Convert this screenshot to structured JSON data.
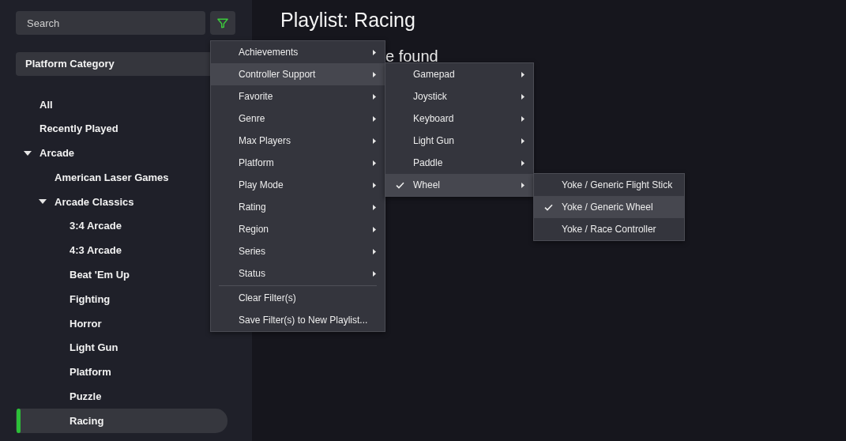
{
  "sidebar": {
    "search": {
      "placeholder": "Search"
    },
    "category_dropdown": {
      "value": "Platform Category"
    },
    "tree": [
      {
        "label": "All",
        "selected": false
      },
      {
        "label": "Recently Played",
        "selected": false
      },
      {
        "label": "Arcade",
        "selected": false,
        "expanded": true,
        "children": [
          {
            "label": "American Laser Games",
            "selected": false
          },
          {
            "label": "Arcade Classics",
            "selected": false,
            "expanded": true,
            "children": [
              {
                "label": "3:4 Arcade",
                "selected": false
              },
              {
                "label": "4:3 Arcade",
                "selected": false
              },
              {
                "label": "Beat 'Em Up",
                "selected": false
              },
              {
                "label": "Fighting",
                "selected": false
              },
              {
                "label": "Horror",
                "selected": false
              },
              {
                "label": "Light Gun",
                "selected": false
              },
              {
                "label": "Platform",
                "selected": false
              },
              {
                "label": "Puzzle",
                "selected": false
              },
              {
                "label": "Racing",
                "selected": true
              }
            ]
          }
        ]
      }
    ]
  },
  "main": {
    "title": "Playlist: Racing",
    "message": "e found"
  },
  "filter_menu": {
    "sections": [
      {
        "items": [
          {
            "label": "Achievements",
            "kind": "submenu",
            "highlighted": false
          },
          {
            "label": "Controller Support",
            "kind": "submenu",
            "highlighted": true,
            "children": [
              {
                "label": "Gamepad",
                "kind": "submenu",
                "highlighted": false,
                "checked": false
              },
              {
                "label": "Joystick",
                "kind": "submenu",
                "highlighted": false,
                "checked": false
              },
              {
                "label": "Keyboard",
                "kind": "submenu",
                "highlighted": false,
                "checked": false
              },
              {
                "label": "Light Gun",
                "kind": "submenu",
                "highlighted": false,
                "checked": false
              },
              {
                "label": "Paddle",
                "kind": "submenu",
                "highlighted": false,
                "checked": false
              },
              {
                "label": "Wheel",
                "kind": "submenu",
                "highlighted": true,
                "checked": true,
                "children": [
                  {
                    "label": "Yoke / Generic Flight Stick",
                    "kind": "command",
                    "highlighted": false,
                    "checked": false
                  },
                  {
                    "label": "Yoke / Generic Wheel",
                    "kind": "command",
                    "highlighted": true,
                    "checked": true
                  },
                  {
                    "label": "Yoke / Race Controller",
                    "kind": "command",
                    "highlighted": false,
                    "checked": false
                  }
                ]
              }
            ]
          },
          {
            "label": "Favorite",
            "kind": "submenu",
            "highlighted": false
          },
          {
            "label": "Genre",
            "kind": "submenu",
            "highlighted": false
          },
          {
            "label": "Max Players",
            "kind": "submenu",
            "highlighted": false
          },
          {
            "label": "Platform",
            "kind": "submenu",
            "highlighted": false
          },
          {
            "label": "Play Mode",
            "kind": "submenu",
            "highlighted": false
          },
          {
            "label": "Rating",
            "kind": "submenu",
            "highlighted": false
          },
          {
            "label": "Region",
            "kind": "submenu",
            "highlighted": false
          },
          {
            "label": "Series",
            "kind": "submenu",
            "highlighted": false
          },
          {
            "label": "Status",
            "kind": "submenu",
            "highlighted": false
          }
        ]
      },
      {
        "items": [
          {
            "label": "Clear Filter(s)",
            "kind": "command",
            "highlighted": false
          },
          {
            "label": "Save Filter(s) to New Playlist...",
            "kind": "command",
            "highlighted": false
          }
        ]
      }
    ]
  }
}
